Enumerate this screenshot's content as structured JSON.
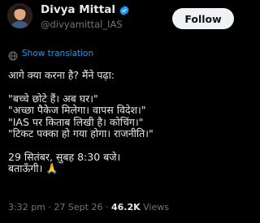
{
  "author": {
    "name": "Divya Mittal",
    "handle": "@divyamittal_IAS",
    "verified_icon": "verified-badge-icon"
  },
  "follow_label": "Follow",
  "translation": {
    "label": "Show translation",
    "icon": "globe-icon"
  },
  "tweet": {
    "intro": "आगे क्या करना है? मैंने पढ़ा:",
    "quotes": [
      "\"बच्चे छोटे हैं। अब घर।\"",
      "\"अच्छा पैकेज मिलेगा। वापस विदेश।\"",
      "\"IAS पर किताब लिखी है। कोचिंग।\"",
      "\"टिकट पक्का हो गया होगा। राजनीति।\""
    ],
    "closing": [
      "29 सितंबर, सुबह 8:30 बजे।",
      "बताऊँगी। 🙏"
    ]
  },
  "meta": {
    "time": "3:32 pm",
    "separator": "·",
    "date": "27 Sept 26",
    "views_count": "46.2K",
    "views_label": "Views"
  },
  "colors": {
    "background": "#000000",
    "text": "#e7e9ea",
    "muted": "#71767b",
    "link": "#1d9bf0",
    "verified": "#1d9bf0",
    "button_bg": "#eff3f4"
  }
}
